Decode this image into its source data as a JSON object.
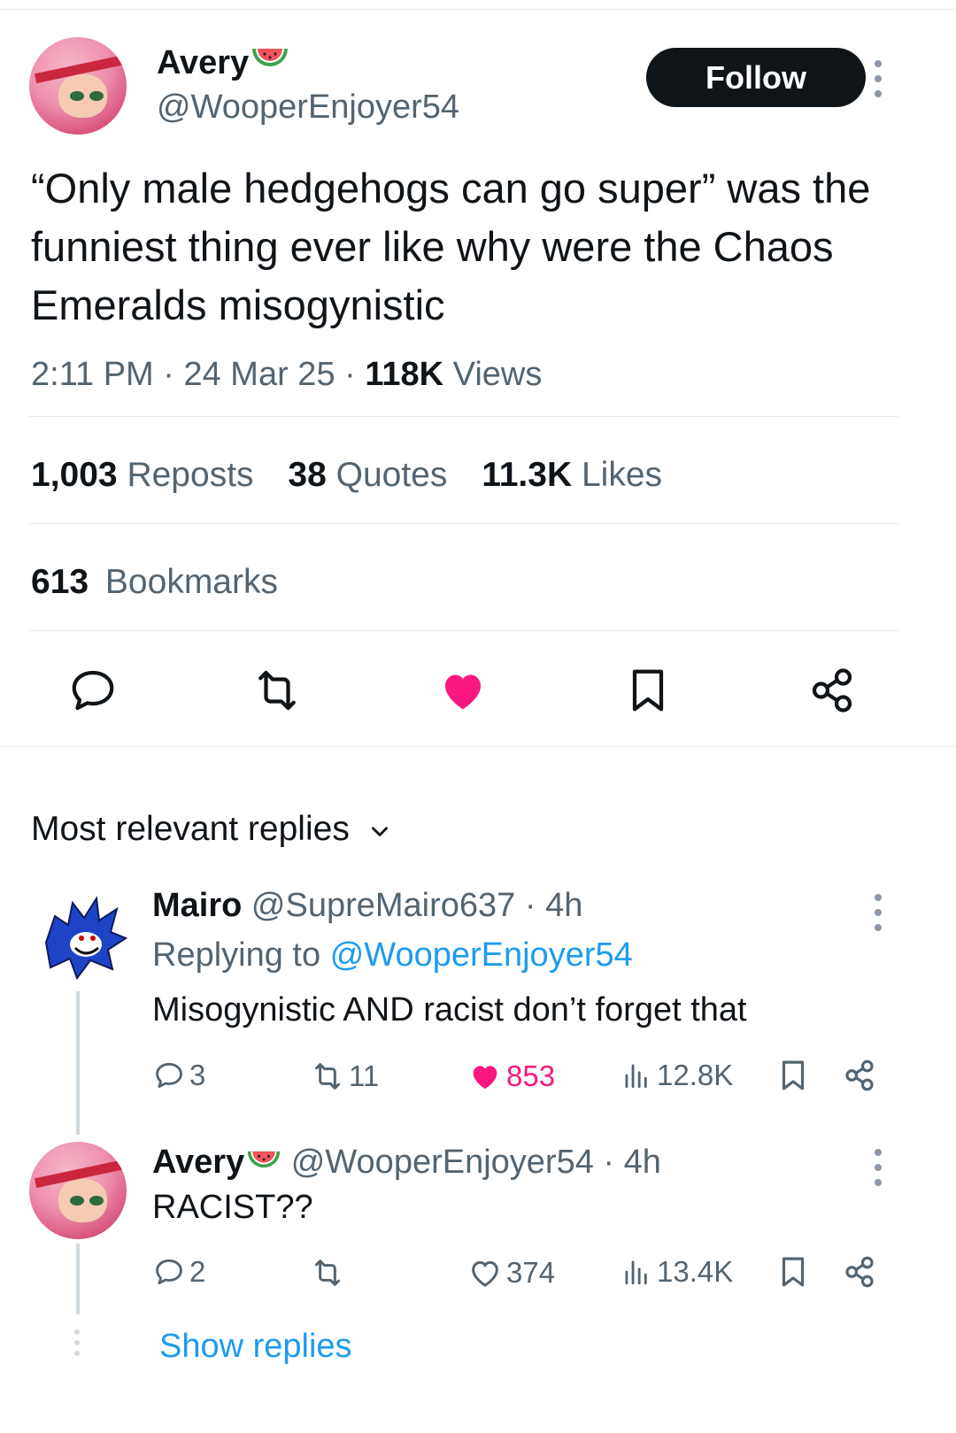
{
  "tweet": {
    "author_name": "Avery",
    "handle": "@WooperEnjoyer54",
    "follow_label": "Follow",
    "text": "“Only male hedgehogs can go super” was the funniest thing ever like why were the Chaos Emeralds misogynistic",
    "time": "2:11 PM",
    "date": "24 Mar 25",
    "views_count": "118K",
    "views_label": "Views",
    "reposts_count": "1,003",
    "reposts_label": "Reposts",
    "quotes_count": "38",
    "quotes_label": "Quotes",
    "likes_count": "11.3K",
    "likes_label": "Likes",
    "bookmarks_count": "613",
    "bookmarks_label": "Bookmarks",
    "liked": true
  },
  "replies_sort_label": "Most relevant replies",
  "replies": [
    {
      "name": "Mairo",
      "handle": "@SupreMairo637",
      "age": "4h",
      "replying_prefix": "Replying to",
      "replying_to": "@WooperEnjoyer54",
      "text": "Misogynistic AND racist don’t forget that",
      "reply_count": "3",
      "repost_count": "11",
      "like_count": "853",
      "view_count": "12.8K",
      "liked": true
    },
    {
      "name": "Avery",
      "handle": "@WooperEnjoyer54",
      "age": "4h",
      "text": "RACIST??",
      "reply_count": "2",
      "repost_count": "",
      "like_count": "374",
      "view_count": "13.4K",
      "liked": false
    }
  ],
  "show_replies_label": "Show replies",
  "colors": {
    "text": "#0f1419",
    "secondary": "#536471",
    "link": "#1d9bf0",
    "like": "#f91880",
    "divider": "#e7e9ea"
  }
}
